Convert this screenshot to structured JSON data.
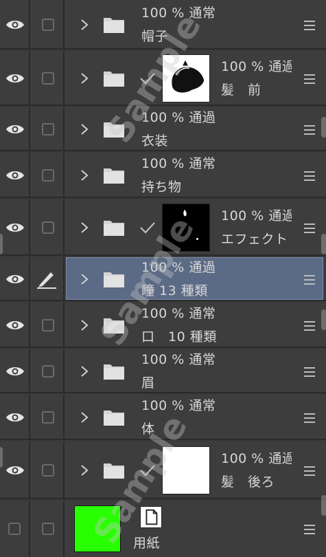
{
  "layers": [
    {
      "opacity": "100 %",
      "blend": "通常",
      "name": "帽子",
      "thumb": null,
      "pen": false,
      "selected": false
    },
    {
      "opacity": "100 %",
      "blend": "通過",
      "name": "髪　前",
      "thumb": "hair-front",
      "pen": false,
      "selected": false
    },
    {
      "opacity": "100 %",
      "blend": "通過",
      "name": "衣装",
      "thumb": null,
      "pen": false,
      "selected": false
    },
    {
      "opacity": "100 %",
      "blend": "通常",
      "name": "持ち物",
      "thumb": null,
      "pen": false,
      "selected": false
    },
    {
      "opacity": "100 %",
      "blend": "通過",
      "name": "エフェクト",
      "thumb": "effect",
      "pen": false,
      "selected": false
    },
    {
      "opacity": "100 %",
      "blend": "通過",
      "name": "瞳 13 種類",
      "thumb": null,
      "pen": true,
      "selected": true
    },
    {
      "opacity": "100 %",
      "blend": "通常",
      "name": "口　10 種類",
      "thumb": null,
      "pen": false,
      "selected": false
    },
    {
      "opacity": "100 %",
      "blend": "通常",
      "name": "眉",
      "thumb": null,
      "pen": false,
      "selected": false
    },
    {
      "opacity": "100 %",
      "blend": "通常",
      "name": "体",
      "thumb": null,
      "pen": false,
      "selected": false
    },
    {
      "opacity": "100 %",
      "blend": "通過",
      "name": "髪　後ろ",
      "thumb": "hair-back",
      "pen": false,
      "selected": false
    }
  ],
  "paper": {
    "name": "用紙",
    "color": "#28ff00"
  },
  "watermark": "Sample",
  "icons": {
    "visibility": "eye-icon",
    "lock": "checkbox-icon",
    "expand": "chevron-right-icon",
    "folder": "folder-icon",
    "mask": "check-icon",
    "menu": "hamburger-icon",
    "edit": "pen-icon"
  },
  "colors": {
    "panel": "#3d3d3d",
    "selected": "#5b6a85",
    "paper": "#28ff00"
  }
}
